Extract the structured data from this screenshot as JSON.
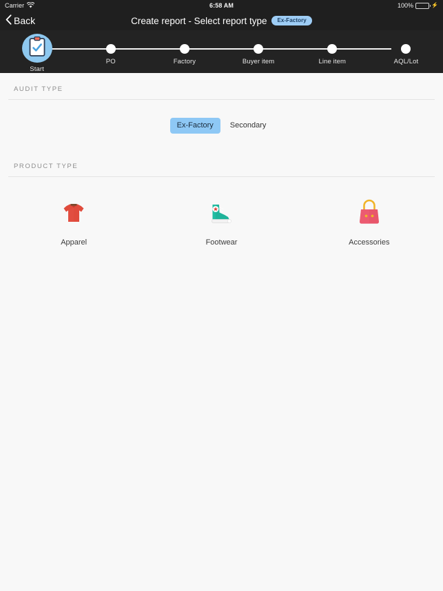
{
  "statusbar": {
    "carrier": "Carrier",
    "wifi_icon": "wifi-icon",
    "time": "6:58 AM",
    "battery_percent": "100%",
    "battery_icon": "battery-full-icon",
    "charging_icon": "lightning-bolt-icon"
  },
  "navbar": {
    "back_label": "Back",
    "back_icon": "chevron-left-icon",
    "title": "Create report - Select report type",
    "badge": "Ex-Factory",
    "badge_bg": "#9ecdf5",
    "badge_text_color": "#1c3f63"
  },
  "stepper": {
    "active_index": 0,
    "active_icon": "clipboard-check-icon",
    "steps": [
      {
        "label": "Start"
      },
      {
        "label": "PO"
      },
      {
        "label": "Factory"
      },
      {
        "label": "Buyer item"
      },
      {
        "label": "Line item"
      },
      {
        "label": "AQL/Lot"
      }
    ]
  },
  "audit_type": {
    "header": "AUDIT TYPE",
    "selected": "Ex-Factory",
    "options": [
      {
        "label": "Ex-Factory",
        "selected": true
      },
      {
        "label": "Secondary",
        "selected": false
      }
    ],
    "selected_bg": "#8ec8f5"
  },
  "product_type": {
    "header": "PRODUCT TYPE",
    "items": [
      {
        "label": "Apparel",
        "icon": "tshirt-icon",
        "color": "#e04b3c"
      },
      {
        "label": "Footwear",
        "icon": "sneaker-icon",
        "color": "#1fb39a"
      },
      {
        "label": "Accessories",
        "icon": "handbag-icon",
        "color": "#e8566b"
      }
    ]
  },
  "theme": {
    "navbar_bg": "#1f1f1f",
    "stepper_bg": "#232323",
    "content_bg": "#f8f8f8",
    "accent": "#8ec8f5"
  }
}
